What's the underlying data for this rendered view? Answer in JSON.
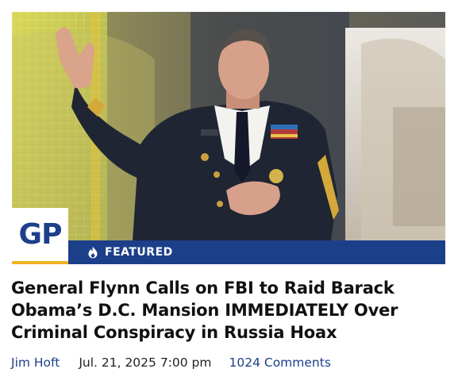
{
  "brand": {
    "logo_text": "GP",
    "accent_color": "#f0b422",
    "brand_color": "#1c3f8a"
  },
  "article": {
    "badge_label": "FEATURED",
    "badge_icon": "fire-icon",
    "headline": "General Flynn Calls on FBI to Raid Barack Obama’s D.C. Mansion IMMEDIATELY Over Criminal Conspiracy in Russia Hoax",
    "author": "Jim Hoft",
    "date": "Jul. 21, 2025 7:00 pm",
    "comments": "1024 Comments"
  }
}
